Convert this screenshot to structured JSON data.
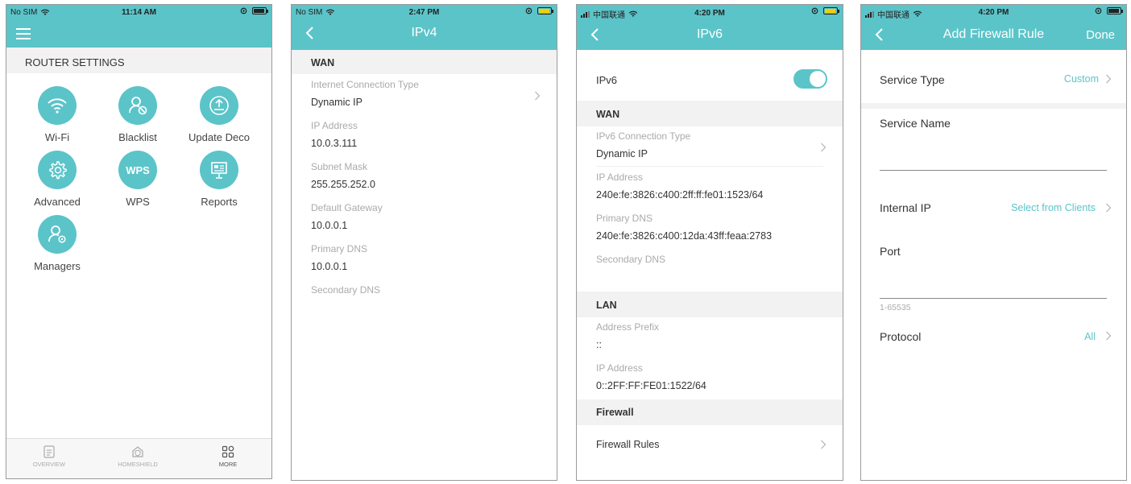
{
  "colors": {
    "accent": "#5bc4c9",
    "section_bg": "#f2f2f2"
  },
  "panel1": {
    "status": {
      "carrier": "No SIM",
      "time": "11:14 AM"
    },
    "section_title": "ROUTER SETTINGS",
    "tiles": [
      {
        "label": "Wi-Fi",
        "icon": "wifi-icon"
      },
      {
        "label": "Blacklist",
        "icon": "blacklist-user-icon"
      },
      {
        "label": "Update Deco",
        "icon": "update-icon"
      },
      {
        "label": "Advanced",
        "icon": "gear-icon"
      },
      {
        "label": "WPS",
        "icon": "wps-icon",
        "icon_text": "WPS"
      },
      {
        "label": "Reports",
        "icon": "reports-icon"
      },
      {
        "label": "Managers",
        "icon": "managers-icon"
      }
    ],
    "tabs": [
      {
        "label": "OVERVIEW",
        "icon": "overview-icon",
        "active": false
      },
      {
        "label": "HOMESHIELD",
        "icon": "homeshield-icon",
        "active": false
      },
      {
        "label": "MORE",
        "icon": "more-icon",
        "active": true
      }
    ]
  },
  "panel2": {
    "status": {
      "carrier": "No SIM",
      "time": "2:47 PM"
    },
    "title": "IPv4",
    "section": "WAN",
    "fields": [
      {
        "key": "Internet Connection Type",
        "value": "Dynamic IP"
      },
      {
        "key": "IP Address",
        "value": "10.0.3.111"
      },
      {
        "key": "Subnet Mask",
        "value": "255.255.252.0"
      },
      {
        "key": "Default Gateway",
        "value": "10.0.0.1"
      },
      {
        "key": "Primary DNS",
        "value": "10.0.0.1"
      },
      {
        "key": "Secondary DNS",
        "value": ""
      }
    ]
  },
  "panel3": {
    "status": {
      "carrier": "中国联通",
      "time": "4:20 PM"
    },
    "title": "IPv6",
    "toggle_label": "IPv6",
    "toggle_on": true,
    "wan_section": "WAN",
    "wan_fields": [
      {
        "key": "IPv6 Connection Type",
        "value": "Dynamic IP"
      },
      {
        "key": "IP Address",
        "value": "240e:fe:3826:c400:2ff:ff:fe01:1523/64"
      },
      {
        "key": "Primary DNS",
        "value": "240e:fe:3826:c400:12da:43ff:feaa:2783"
      },
      {
        "key": "Secondary DNS",
        "value": ""
      }
    ],
    "lan_section": "LAN",
    "lan_fields": [
      {
        "key": "Address Prefix",
        "value": "::"
      },
      {
        "key": "IP Address",
        "value": "0::2FF:FF:FE01:1522/64"
      }
    ],
    "firewall_section": "Firewall",
    "firewall_rules_label": "Firewall Rules"
  },
  "panel4": {
    "status": {
      "carrier": "中国联通",
      "time": "4:20 PM"
    },
    "title": "Add Firewall Rule",
    "done_label": "Done",
    "service_type_label": "Service Type",
    "service_type_value": "Custom",
    "service_name_label": "Service Name",
    "internal_ip_label": "Internal IP",
    "internal_ip_value": "Select from Clients",
    "port_label": "Port",
    "port_hint": "1-65535",
    "protocol_label": "Protocol",
    "protocol_value": "All"
  }
}
